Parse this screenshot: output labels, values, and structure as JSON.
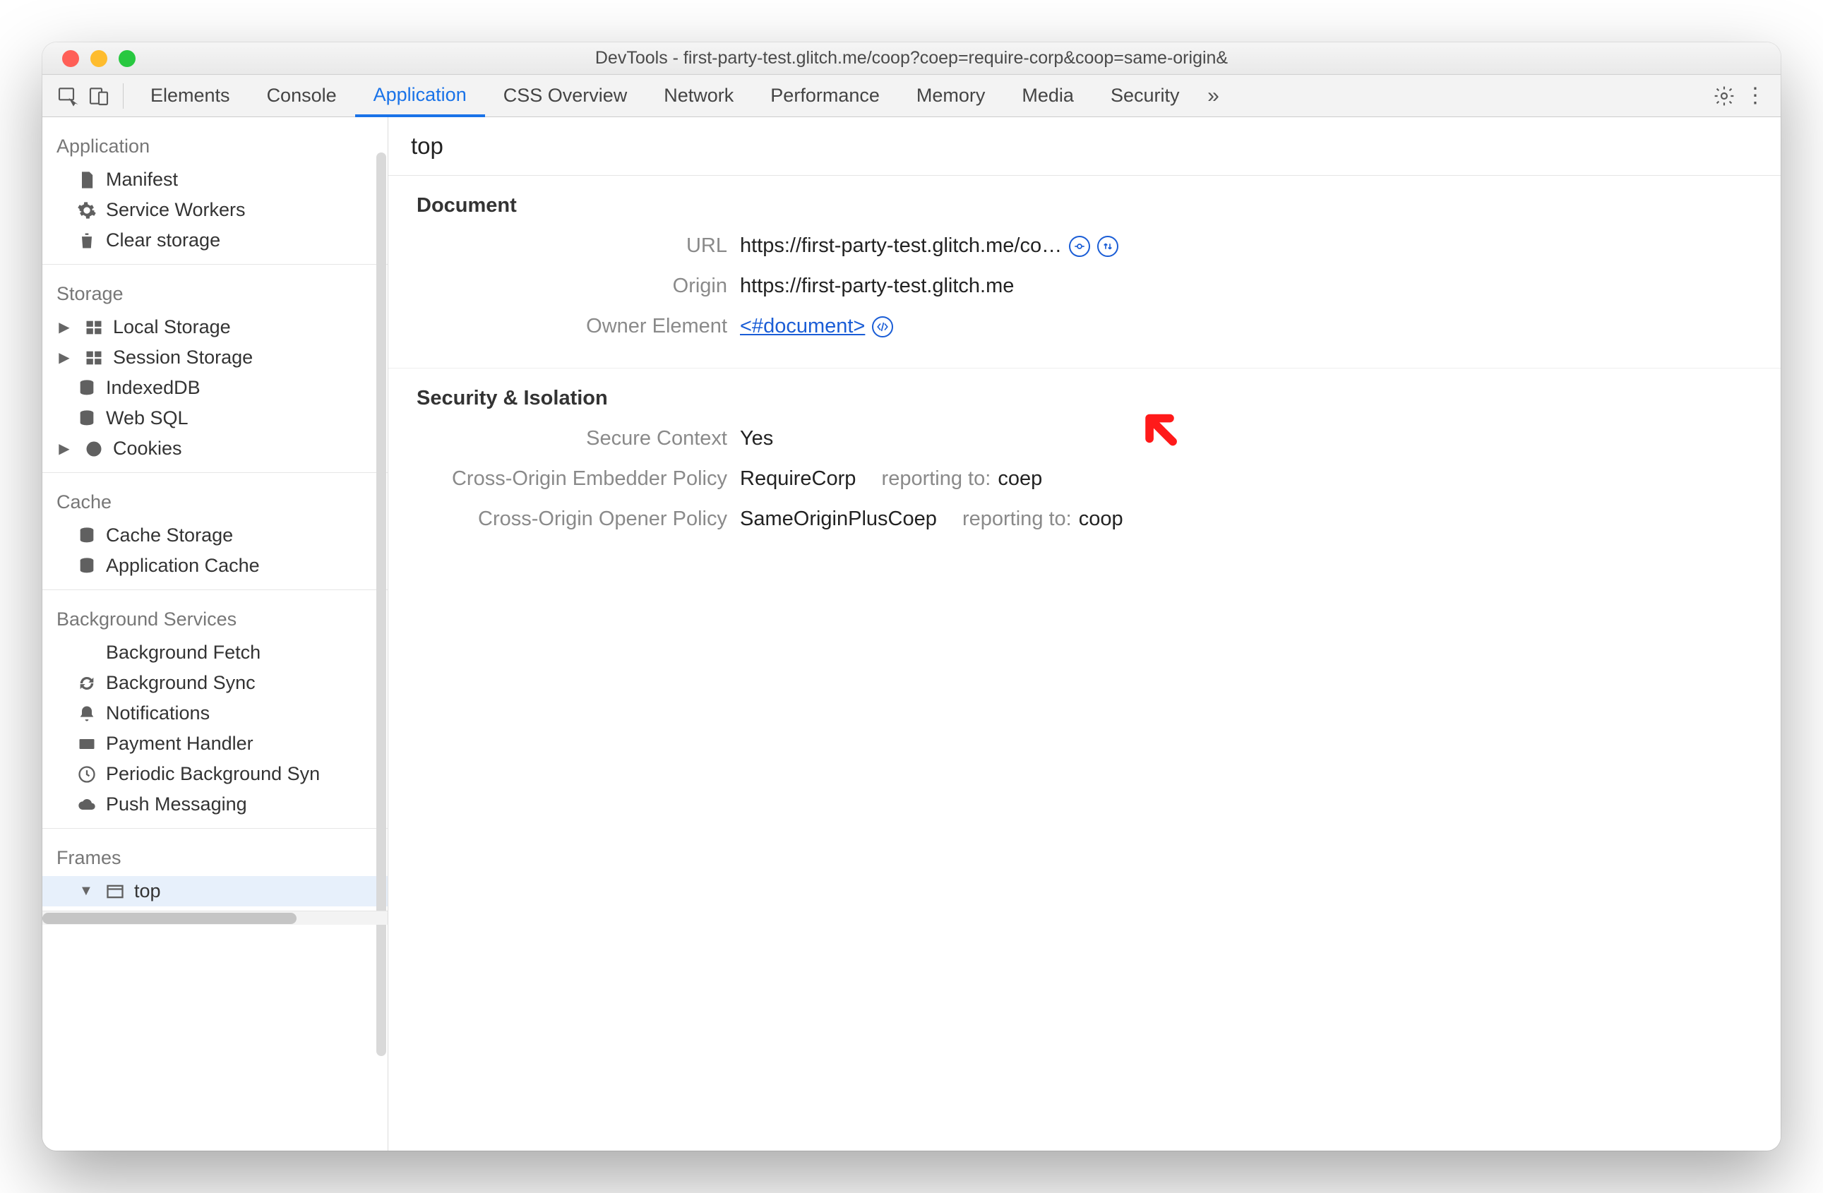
{
  "window_title": "DevTools - first-party-test.glitch.me/coop?coep=require-corp&coop=same-origin&",
  "tabs": {
    "t0": "Elements",
    "t1": "Console",
    "t2": "Application",
    "t3": "CSS Overview",
    "t4": "Network",
    "t5": "Performance",
    "t6": "Memory",
    "t7": "Media",
    "t8": "Security"
  },
  "sidebar": {
    "application": {
      "title": "Application",
      "manifest": "Manifest",
      "service_workers": "Service Workers",
      "clear_storage": "Clear storage"
    },
    "storage": {
      "title": "Storage",
      "local": "Local Storage",
      "session": "Session Storage",
      "indexeddb": "IndexedDB",
      "websql": "Web SQL",
      "cookies": "Cookies"
    },
    "cache": {
      "title": "Cache",
      "cache_storage": "Cache Storage",
      "app_cache": "Application Cache"
    },
    "bg": {
      "title": "Background Services",
      "fetch": "Background Fetch",
      "sync": "Background Sync",
      "notif": "Notifications",
      "pay": "Payment Handler",
      "periodic": "Periodic Background Syn",
      "push": "Push Messaging"
    },
    "frames": {
      "title": "Frames",
      "top": "top"
    }
  },
  "main": {
    "title": "top",
    "document": {
      "heading": "Document",
      "url_label": "URL",
      "url_value": "https://first-party-test.glitch.me/co…",
      "origin_label": "Origin",
      "origin_value": "https://first-party-test.glitch.me",
      "owner_label": "Owner Element",
      "owner_link": "<#document>"
    },
    "security": {
      "heading": "Security & Isolation",
      "secure_label": "Secure Context",
      "secure_value": "Yes",
      "coep_label": "Cross-Origin Embedder Policy",
      "coep_value": "RequireCorp",
      "coep_report_label": "reporting to:",
      "coep_report_value": "coep",
      "coop_label": "Cross-Origin Opener Policy",
      "coop_value": "SameOriginPlusCoep",
      "coop_report_label": "reporting to:",
      "coop_report_value": "coop"
    }
  }
}
